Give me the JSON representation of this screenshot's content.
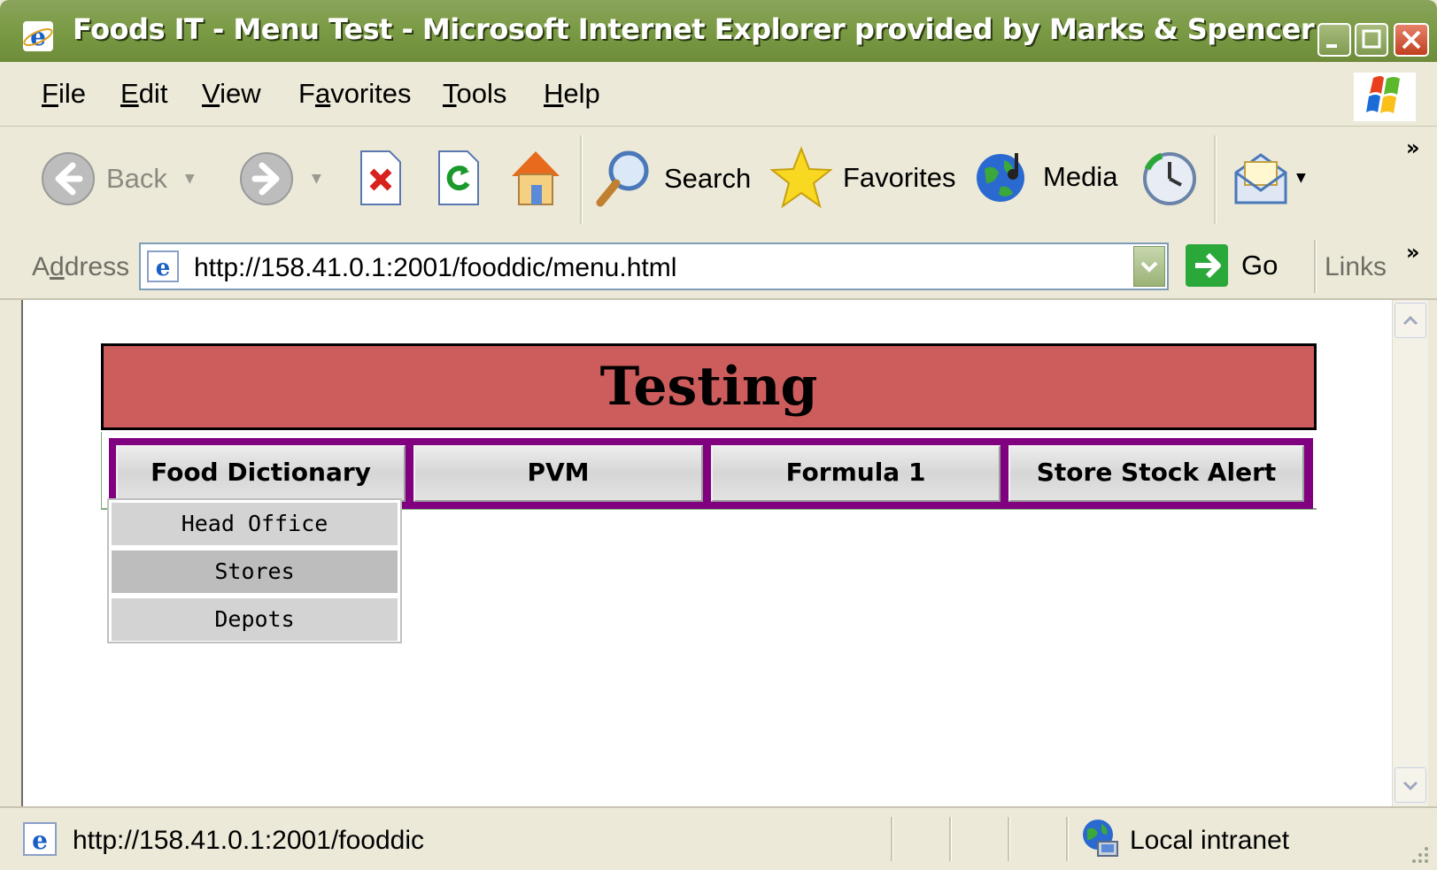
{
  "window": {
    "title": "Foods IT - Menu Test - Microsoft Internet Explorer provided by Marks & Spencer"
  },
  "menubar": {
    "items": [
      {
        "label": "File",
        "accel": "F",
        "rest": "ile"
      },
      {
        "label": "Edit",
        "accel": "E",
        "rest": "dit"
      },
      {
        "label": "View",
        "accel": "V",
        "rest": "iew"
      },
      {
        "label": "Favorites",
        "pre": "F",
        "accel": "a",
        "rest": "vorites"
      },
      {
        "label": "Tools",
        "accel": "T",
        "rest": "ools"
      },
      {
        "label": "Help",
        "accel": "H",
        "rest": "elp"
      }
    ]
  },
  "toolbar": {
    "back_label": "Back",
    "search_label": "Search",
    "favorites_label": "Favorites",
    "media_label": "Media",
    "more_glyph": "»"
  },
  "addressbar": {
    "label_pre": "A",
    "label_accel": "d",
    "label_rest": "dress",
    "url": "http://158.41.0.1:2001/fooddic/menu.html",
    "go_label": "Go",
    "links_label": "Links",
    "more_glyph": "»"
  },
  "page": {
    "banner_title": "Testing",
    "nav": [
      {
        "label": "Food Dictionary"
      },
      {
        "label": "PVM"
      },
      {
        "label": "Formula 1"
      },
      {
        "label": "Store Stock Alert"
      }
    ],
    "dropdown": [
      {
        "label": "Head Office"
      },
      {
        "label": "Stores"
      },
      {
        "label": "Depots"
      }
    ]
  },
  "statusbar": {
    "url": "http://158.41.0.1:2001/fooddic",
    "zone": "Local intranet"
  },
  "colors": {
    "banner_bg": "#cd5c5c",
    "nav_bg": "#800080",
    "titlebar": "#7a9a44"
  }
}
